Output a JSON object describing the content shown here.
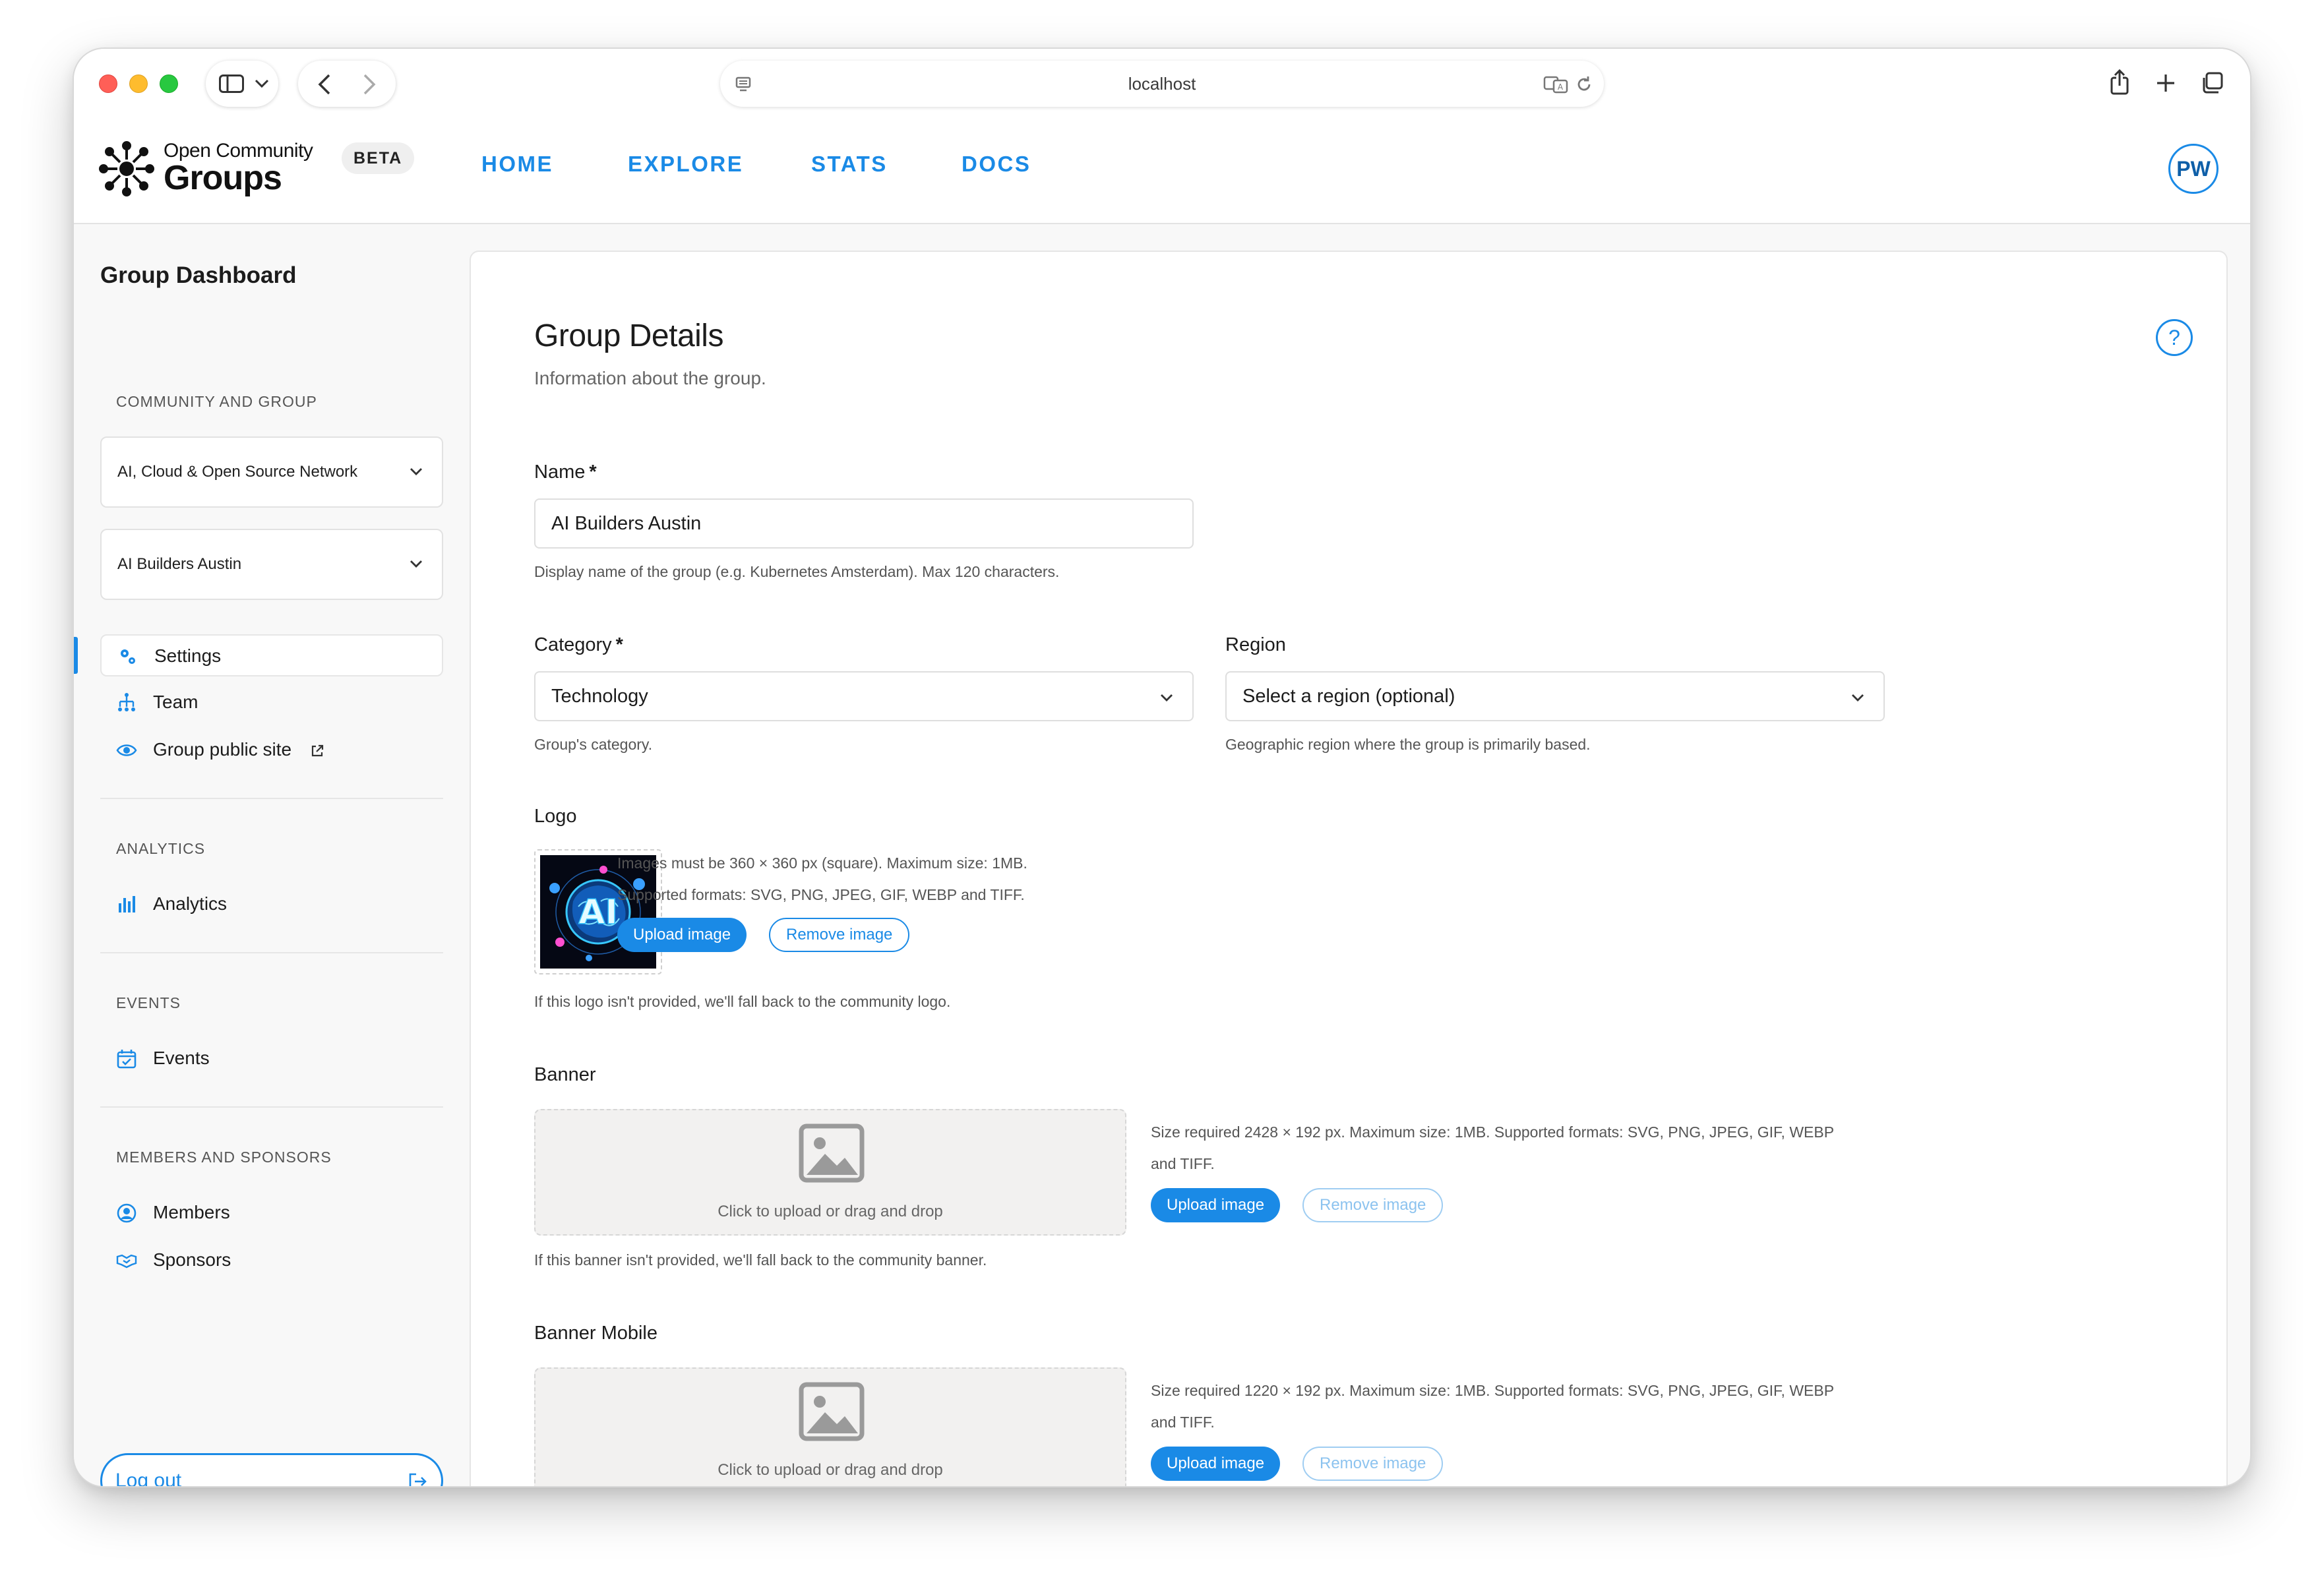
{
  "browser": {
    "url": "localhost"
  },
  "header": {
    "brand_top": "Open Community",
    "brand_bottom": "Groups",
    "badge": "BETA",
    "nav": [
      "HOME",
      "EXPLORE",
      "STATS",
      "DOCS"
    ],
    "avatar_initials": "PW",
    "accent_color": "#1a8ae6"
  },
  "sidebar": {
    "title": "Group Dashboard",
    "sections": {
      "community": "COMMUNITY AND GROUP",
      "analytics": "ANALYTICS",
      "events": "EVENTS",
      "members": "MEMBERS AND SPONSORS"
    },
    "community_select": "AI, Cloud & Open Source Network",
    "group_select": "AI Builders Austin",
    "items": {
      "settings": "Settings",
      "team": "Team",
      "public_site": "Group public site",
      "analytics": "Analytics",
      "events": "Events",
      "members": "Members",
      "sponsors": "Sponsors"
    },
    "logout": "Log out"
  },
  "main": {
    "title": "Group Details",
    "subtitle": "Information about the group.",
    "help_icon": "?",
    "name": {
      "label": "Name",
      "required": "*",
      "value": "AI Builders Austin",
      "hint": "Display name of the group (e.g. Kubernetes Amsterdam). Max 120 characters."
    },
    "category": {
      "label": "Category",
      "required": "*",
      "value": "Technology",
      "hint": "Group's category."
    },
    "region": {
      "label": "Region",
      "value": "Select a region (optional)",
      "hint": "Geographic region where the group is primarily based."
    },
    "logo": {
      "label": "Logo",
      "logo_text": "AI",
      "info_line1": "Images must be 360 × 360 px (square). Maximum size: 1MB.",
      "info_line2": "Supported formats: SVG, PNG, JPEG, GIF, WEBP and TIFF.",
      "upload": "Upload image",
      "remove": "Remove image",
      "hint": "If this logo isn't provided, we'll fall back to the community logo."
    },
    "banner": {
      "label": "Banner",
      "dropzone": "Click to upload or drag and drop",
      "info_line1": "Size required 2428 × 192 px. Maximum size: 1MB. Supported formats: SVG, PNG, JPEG, GIF, WEBP",
      "info_line2": "and TIFF.",
      "upload": "Upload image",
      "remove": "Remove image",
      "hint": "If this banner isn't provided, we'll fall back to the community banner."
    },
    "banner_mobile": {
      "label": "Banner Mobile",
      "dropzone": "Click to upload or drag and drop",
      "info_line1": "Size required 1220 × 192 px. Maximum size: 1MB. Supported formats: SVG, PNG, JPEG, GIF, WEBP",
      "info_line2": "and TIFF.",
      "upload": "Upload image",
      "remove": "Remove image"
    }
  }
}
